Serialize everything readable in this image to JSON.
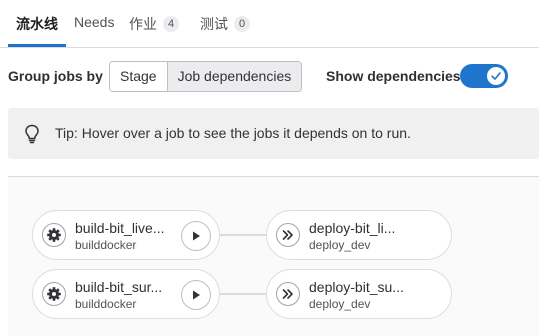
{
  "tabs": [
    {
      "label": "流水线",
      "active": true
    },
    {
      "label": "Needs"
    },
    {
      "label": "作业",
      "count": "4"
    },
    {
      "label": "测试",
      "count": "0"
    }
  ],
  "controls": {
    "group_label": "Group jobs by",
    "stage_button": "Stage",
    "job_dependencies_button": "Job dependencies",
    "selected": "Job dependencies",
    "show_dependencies_label": "Show dependencies",
    "show_dependencies_on": true
  },
  "tip": {
    "icon": "lightbulb-icon",
    "text": "Tip: Hover over a job to see the jobs it depends on to run."
  },
  "jobs_left": [
    {
      "name": "build-bit_live...",
      "stage": "builddocker",
      "status_icon": "gear-icon",
      "action_icon": "play-icon"
    },
    {
      "name": "build-bit_sur...",
      "stage": "builddocker",
      "status_icon": "gear-icon",
      "action_icon": "play-icon"
    }
  ],
  "jobs_right": [
    {
      "name": "deploy-bit_li...",
      "stage": "deploy_dev",
      "status_icon": "skipped-icon"
    },
    {
      "name": "deploy-bit_su...",
      "stage": "deploy_dev",
      "status_icon": "skipped-icon"
    }
  ],
  "colors": {
    "accent": "#1f75cb",
    "tip_background": "#f0f0f0",
    "graph_background": "#fafafa"
  }
}
